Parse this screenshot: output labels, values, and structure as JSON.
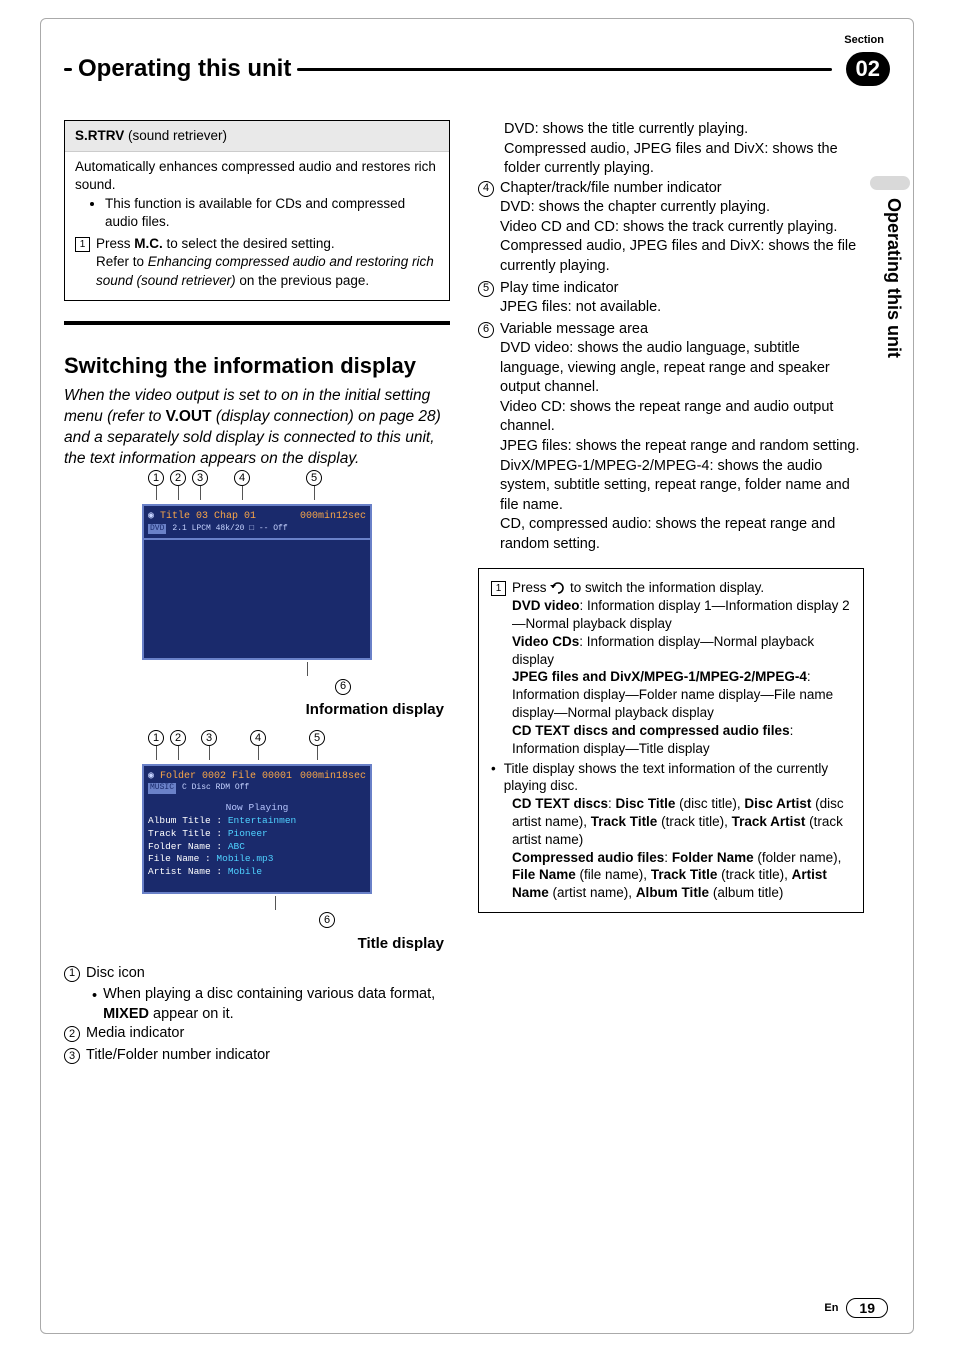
{
  "header": {
    "section_label": "Section",
    "chapter_title": "Operating this unit",
    "chapter_number": "02",
    "side_tab": "Operating this unit"
  },
  "left": {
    "srtrv_box": {
      "header_bold": "S.RTRV",
      "header_rest": " (sound retriever)",
      "para": "Automatically enhances compressed audio and restores rich sound.",
      "bullet": "This function is available for CDs and compressed audio files.",
      "step_prefix": "Press ",
      "step_bold": "M.C.",
      "step_rest": " to select the desired setting.",
      "step_detail_a": "Refer to ",
      "step_detail_italic": "Enhancing compressed audio and restoring rich sound (sound retriever)",
      "step_detail_b": " on the previous page."
    },
    "switch_heading": "Switching the information display",
    "switch_para_a": "When the video output is set to on in the initial setting menu (refer to ",
    "switch_para_bold": "V.OUT",
    "switch_para_b": " (display connection) on page 28) and a separately sold display is connected to this unit, the text information appears on the display.",
    "callouts_top": [
      "1",
      "2",
      "3",
      "4",
      "5"
    ],
    "callout_bottom": "6",
    "screen1": {
      "dvd_badge": "DVD",
      "title": "Title 03",
      "chap": "Chap 01",
      "time": "000min12sec",
      "row2": "2.1   LPCM  48k/20   □ -- Off"
    },
    "caption1": "Information display",
    "callouts2_top": [
      "1",
      "2",
      "3",
      "4",
      "5"
    ],
    "screen2": {
      "music_badge": "MUSIC",
      "folder": "Folder 0002",
      "file": "File 00001",
      "time": "000min18sec",
      "row2": "C   Disc   RDM  Off",
      "now_playing": "Now Playing",
      "album_label": "Album Title :",
      "album_val": "Entertainmen",
      "track_label": "Track Title :",
      "track_val": "Pioneer",
      "folder_label": "Folder Name :",
      "folder_val": "ABC",
      "file_label": "File Name :",
      "file_val": "Mobile.mp3",
      "artist_label": "Artist Name :",
      "artist_val": "Mobile"
    },
    "caption2": "Title display",
    "legend": {
      "n1": "Disc icon",
      "n1_sub_a": "When playing a disc containing various data format, ",
      "n1_sub_bold": "MIXED",
      "n1_sub_b": " appear on it.",
      "n2": "Media indicator",
      "n3": "Title/Folder number indicator"
    }
  },
  "right": {
    "cont": {
      "dvd_line": "DVD: shows the title currently playing.",
      "comp_line": "Compressed audio, JPEG files and DivX: shows the folder currently playing.",
      "n4": "Chapter/track/file number indicator",
      "n4a": "DVD: shows the chapter currently playing.",
      "n4b": "Video CD and CD: shows the track currently playing.",
      "n4c": "Compressed audio, JPEG files and DivX: shows the file currently playing.",
      "n5": "Play time indicator",
      "n5a": "JPEG files: not available.",
      "n6": "Variable message area",
      "n6a": "DVD video: shows the audio language, subtitle language, viewing angle, repeat range and speaker output channel.",
      "n6b": "Video CD: shows the repeat range and audio output channel.",
      "n6c": "JPEG files: shows the repeat range and random setting.",
      "n6d": "DivX/MPEG-1/MPEG-2/MPEG-4: shows the audio system, subtitle setting, repeat range, folder name and file name.",
      "n6e": "CD, compressed audio: shows the repeat range and random setting."
    },
    "box": {
      "step_a": "Press ",
      "step_b": " to switch the information display.",
      "dvd_b": "DVD video",
      "dvd_t": ": Information display 1—Information display 2—Normal playback display",
      "vcd_b": "Video CDs",
      "vcd_t": ": Information display—Normal playback display",
      "jpeg_b": "JPEG files and DivX/MPEG-1/MPEG-2/MPEG-4",
      "jpeg_t": ": Information display—Folder name display—File name display—Normal playback display",
      "cdt_b": "CD TEXT discs and compressed audio files",
      "cdt_t": ": Information display—Title display",
      "bullet": "Title display shows the text information of the currently playing disc.",
      "cd_b1": "CD TEXT discs",
      "cd_t1": ": ",
      "cd_b2": "Disc Title",
      "cd_t2": " (disc title), ",
      "cd_b3": "Disc Artist",
      "cd_t3": " (disc artist name), ",
      "cd_b4": "Track Title",
      "cd_t4": " (track title), ",
      "cd_b5": "Track Artist",
      "cd_t5": " (track artist name)",
      "ca_b1": "Compressed audio files",
      "ca_t1": ": ",
      "ca_b2": "Folder Name",
      "ca_t2": " (folder name), ",
      "ca_b3": "File Name",
      "ca_t3": " (file name), ",
      "ca_b4": "Track Title",
      "ca_t4": " (track title), ",
      "ca_b5": "Artist Name",
      "ca_t5": " (artist name), ",
      "ca_b6": "Album Title",
      "ca_t6": " (album title)"
    }
  },
  "footer": {
    "lang": "En",
    "page": "19"
  }
}
